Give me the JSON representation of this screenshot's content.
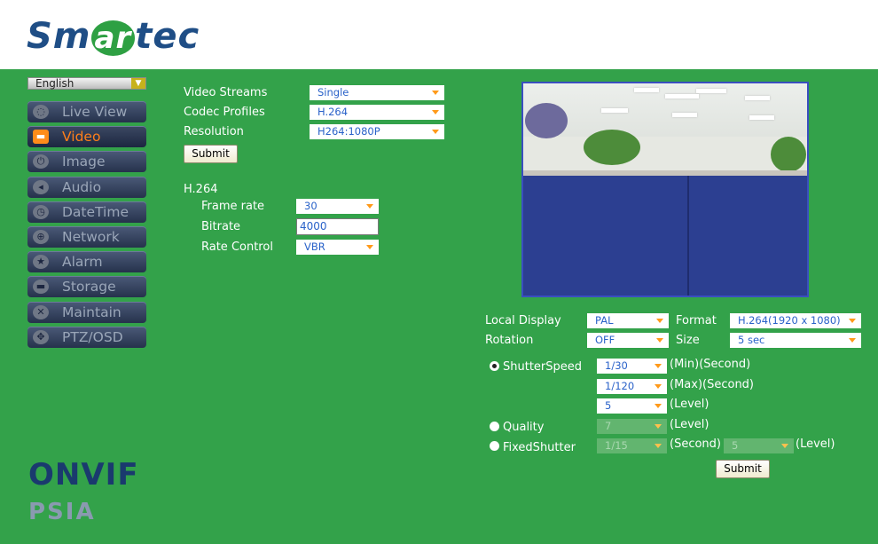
{
  "brand": {
    "logo_pre": "Sm",
    "logo_mid": "ar",
    "logo_post": "tec"
  },
  "language": {
    "selected": "English"
  },
  "nav": [
    {
      "label": "Live View",
      "icon": "chat-bubble-icon",
      "glyph": "◌"
    },
    {
      "label": "Video",
      "icon": "video-camera-icon",
      "glyph": "▬"
    },
    {
      "label": "Image",
      "icon": "power-icon",
      "glyph": "⏻"
    },
    {
      "label": "Audio",
      "icon": "speaker-icon",
      "glyph": "◂"
    },
    {
      "label": "DateTime",
      "icon": "clock-icon",
      "glyph": "◷"
    },
    {
      "label": "Network",
      "icon": "globe-icon",
      "glyph": "⊕"
    },
    {
      "label": "Alarm",
      "icon": "star-icon",
      "glyph": "★"
    },
    {
      "label": "Storage",
      "icon": "storage-icon",
      "glyph": "▬"
    },
    {
      "label": "Maintain",
      "icon": "tools-icon",
      "glyph": "✕"
    },
    {
      "label": "PTZ/OSD",
      "icon": "arrows-icon",
      "glyph": "✥"
    }
  ],
  "logos": {
    "onvif": "ONVIF",
    "psia": "PSIA"
  },
  "stream": {
    "video_streams_label": "Video Streams",
    "video_streams_value": "Single",
    "codec_profiles_label": "Codec Profiles",
    "codec_profiles_value": "H.264",
    "resolution_label": "Resolution",
    "resolution_value": "H264:1080P",
    "submit_label": "Submit"
  },
  "h264": {
    "section_label": "H.264",
    "frame_rate_label": "Frame rate",
    "frame_rate_value": "30",
    "bitrate_label": "Bitrate",
    "bitrate_value": "4000",
    "rate_control_label": "Rate Control",
    "rate_control_value": "VBR"
  },
  "display": {
    "local_display_label": "Local Display",
    "local_display_value": "PAL",
    "format_label": "Format",
    "format_value": "H.264(1920 x 1080)",
    "rotation_label": "Rotation",
    "rotation_value": "OFF",
    "size_label": "Size",
    "size_value": "5 sec"
  },
  "exposure": {
    "shutter_speed_label": "ShutterSpeed",
    "shutter_min_value": "1/30",
    "shutter_min_unit": "(Min)(Second)",
    "shutter_max_value": "1/120",
    "shutter_max_unit": "(Max)(Second)",
    "shutter_level_value": "5",
    "shutter_level_unit": "(Level)",
    "quality_label": "Quality",
    "quality_value": "7",
    "quality_unit": "(Level)",
    "fixed_shutter_label": "FixedShutter",
    "fixed_shutter_value": "1/15",
    "fixed_shutter_unit": "(Second)",
    "fixed_level_value": "5",
    "fixed_level_unit": "(Level)",
    "selected_mode": "ShutterSpeed",
    "submit_label": "Submit"
  },
  "colors": {
    "panel_green": "#33a24a",
    "nav_active": "#ff7f1a",
    "select_text": "#2a62c9"
  }
}
